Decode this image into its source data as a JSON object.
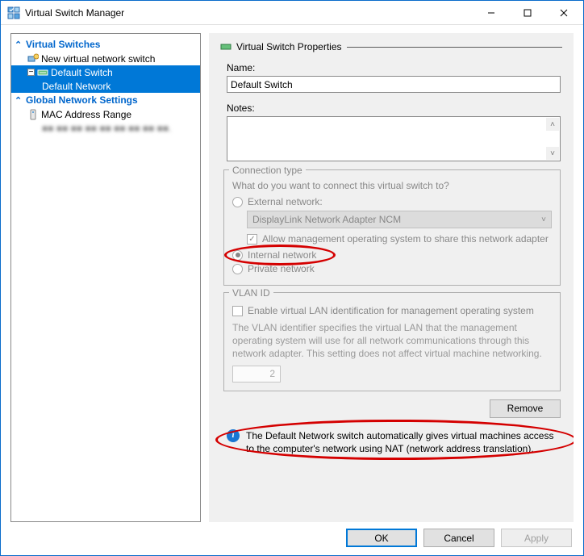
{
  "window": {
    "title": "Virtual Switch Manager"
  },
  "tree": {
    "section1": "Virtual Switches",
    "row_new": "New virtual network switch",
    "row_switch": "Default Switch",
    "row_switch_sub": "Default Network",
    "section2": "Global Network Settings",
    "row_mac": "MAC Address Range"
  },
  "props": {
    "header": "Virtual Switch Properties",
    "name_label": "Name:",
    "name_value": "Default Switch",
    "notes_label": "Notes:",
    "conn": {
      "legend": "Connection type",
      "prompt": "What do you want to connect this virtual switch to?",
      "external": "External network:",
      "adapter": "DisplayLink Network Adapter NCM",
      "allow": "Allow management operating system to share this network adapter",
      "internal": "Internal network",
      "private": "Private network"
    },
    "vlan": {
      "legend": "VLAN ID",
      "enable": "Enable virtual LAN identification for management operating system",
      "desc": "The VLAN identifier specifies the virtual LAN that the management operating system will use for all network communications through this network adapter. This setting does not affect virtual machine networking.",
      "value": "2"
    },
    "remove": "Remove",
    "info": "The Default Network switch automatically gives virtual machines access to the computer's network using NAT (network address translation)."
  },
  "footer": {
    "ok": "OK",
    "cancel": "Cancel",
    "apply": "Apply"
  }
}
